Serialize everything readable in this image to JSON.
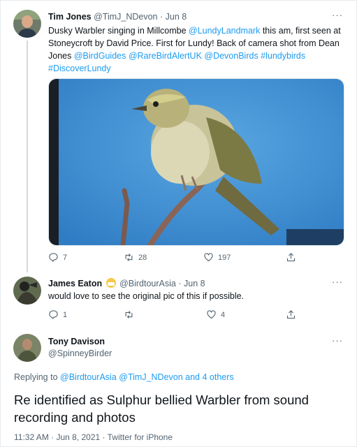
{
  "tweets": [
    {
      "name": "Tim Jones",
      "handle": "@TimJ_NDevon",
      "date": "Jun 8",
      "more": "···",
      "text": {
        "l1a": "Dusky Warbler singing in Millcombe ",
        "l1b": "@LundyLandmark",
        "l1c": " this am, first seen at",
        "l2": "Stoneycroft by David Price. First for Lundy! Back of camera shot from Dean",
        "l3a": "Jones ",
        "l3b": "@BirdGuides @RareBirdAlertUK @DevonBirds #lundybirds",
        "l4": "#DiscoverLundy"
      },
      "replies": "7",
      "retweets": "28",
      "likes": "197"
    },
    {
      "name": "James Eaton",
      "handle": "@BirdtourAsia",
      "date": "Jun 8",
      "more": "···",
      "text": "would love to see the original pic of this if possible.",
      "replies": "1",
      "retweets": "",
      "likes": "4"
    }
  ],
  "main": {
    "name": "Tony Davison",
    "handle": "@SpinneyBirder",
    "more": "···",
    "replying_prefix": "Replying to ",
    "replying_to": "@BirdtourAsia @TimJ_NDevon and 4 others",
    "text_l1": "Re identified as Sulphur bellied Warbler from sound",
    "text_l2": "recording and photos",
    "time": "11:32 AM · Jun 8, 2021 · ",
    "source": "Twitter for iPhone"
  },
  "icons": {
    "reply": "reply-icon",
    "retweet": "retweet-icon",
    "like": "heart-icon",
    "share": "share-icon",
    "emoji": "grinning-face-emoji"
  },
  "colors": {
    "link": "#1d9bf0",
    "muted": "#536471",
    "thread_line": "#cfd9de",
    "sky": "#3f8fd0"
  }
}
